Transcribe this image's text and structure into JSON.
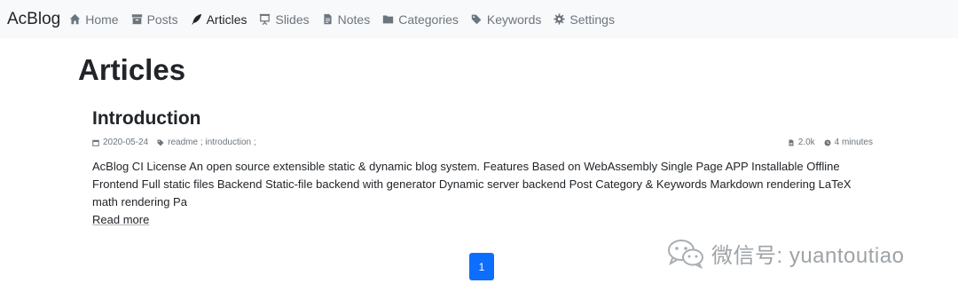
{
  "navbar": {
    "brand": "AcBlog",
    "items": [
      {
        "label": "Home",
        "icon": "home-icon"
      },
      {
        "label": "Posts",
        "icon": "archive-icon"
      },
      {
        "label": "Articles",
        "icon": "feather-icon",
        "active": true
      },
      {
        "label": "Slides",
        "icon": "presentation-icon"
      },
      {
        "label": "Notes",
        "icon": "document-icon"
      },
      {
        "label": "Categories",
        "icon": "folder-icon"
      },
      {
        "label": "Keywords",
        "icon": "tags-icon"
      },
      {
        "label": "Settings",
        "icon": "gear-icon"
      }
    ]
  },
  "page": {
    "title": "Articles"
  },
  "article": {
    "title": "Introduction",
    "date": "2020-05-24",
    "keywords": "readme ; introduction ;",
    "words": "2.0k",
    "read_time": "4 minutes",
    "excerpt": "AcBlog CI License An open source extensible static & dynamic blog system. Features Based on WebAssembly Single Page APP Installable Offline Frontend Full static files Backend Static-file backend with generator Dynamic server backend Post Category & Keywords Markdown rendering LaTeX math rendering Pa",
    "read_more": "Read more"
  },
  "pagination": {
    "current": "1"
  },
  "watermark": {
    "text": "微信号: yuantoutiao"
  },
  "colors": {
    "accent": "#0d6efd",
    "navbar_bg": "#f8f9fa",
    "muted": "#6c757d"
  }
}
